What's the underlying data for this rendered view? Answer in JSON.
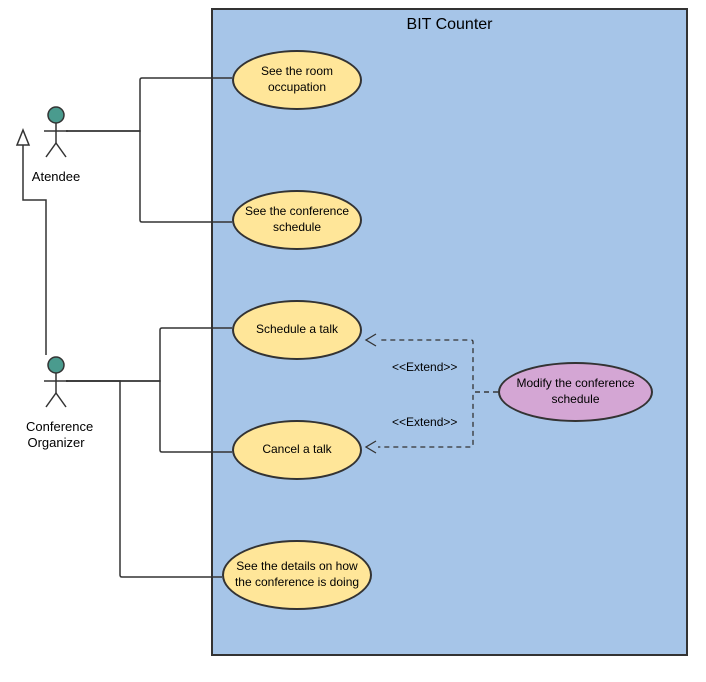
{
  "system": {
    "title": "BIT Counter"
  },
  "actors": {
    "attendee": "Atendee",
    "organizer": "Conference\nOrganizer"
  },
  "usecases": {
    "uc1": "See the room occupation",
    "uc2": "See the conference schedule",
    "uc3": "Schedule a talk",
    "uc4": "Cancel a talk",
    "uc5": "See the details on how the conference is doing",
    "uc6": "Modify the conference schedule"
  },
  "relations": {
    "extend1": "<<Extend>>",
    "extend2": "<<Extend>>"
  }
}
